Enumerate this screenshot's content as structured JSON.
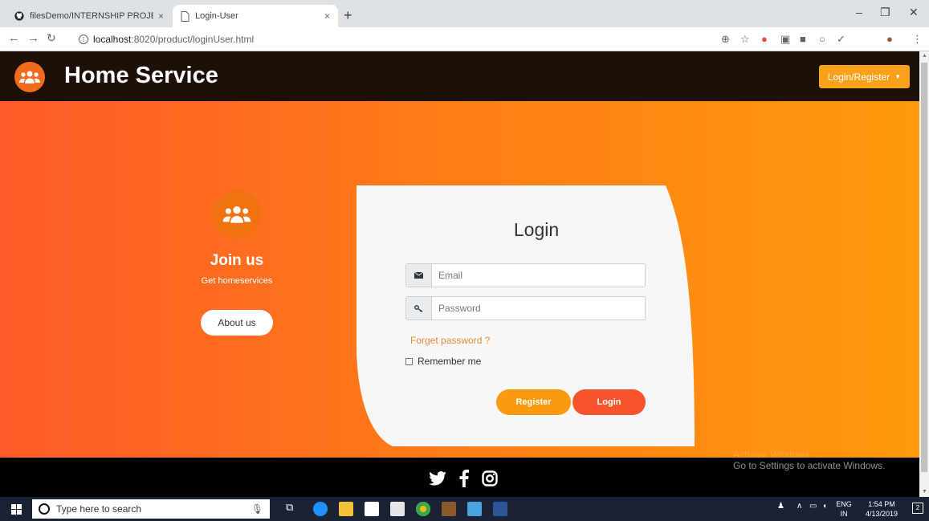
{
  "browser": {
    "tabs": [
      {
        "label": "filesDemo/INTERNSHIP PROJECT",
        "close": "×"
      },
      {
        "label": "Login-User",
        "close": "×"
      }
    ],
    "new_tab": "+",
    "window_controls": [
      "–",
      "❐",
      "✕"
    ],
    "url_host": "localhost",
    "url_path": ":8020/product/loginUser.html"
  },
  "navbar": {
    "brand": "Home Service",
    "login_dropdown": "Login/Register"
  },
  "join": {
    "title": "Join us",
    "subtitle": "Get homeservices",
    "about_button": "About us"
  },
  "login_form": {
    "title": "Login",
    "email_placeholder": "Email",
    "password_placeholder": "Password",
    "forget_link": "Forget password ?",
    "remember_label": "Remember me",
    "register_button": "Register",
    "login_button": "Login"
  },
  "footer": {
    "activate_title": "Activate Windows",
    "activate_message": "Go to Settings to activate Windows."
  },
  "taskbar": {
    "search_placeholder": "Type here to search",
    "lang_top": "ENG",
    "lang_bottom": "IN",
    "time": "1:54 PM",
    "date": "4/13/2019",
    "notifications": "2"
  },
  "colors": {
    "hero_start": "#ff5a28",
    "hero_end": "#ff9a0c",
    "navbar_bg": "#1e1008",
    "register_btn": "#fb9a0e",
    "login_btn": "#f7532c"
  }
}
